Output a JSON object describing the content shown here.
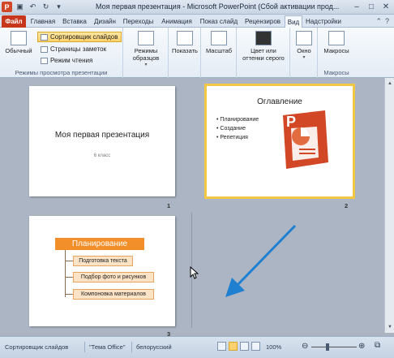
{
  "window": {
    "title": "Моя первая презентация - Microsoft PowerPoint (Сбой активации прод...",
    "app_icon": "P"
  },
  "tabs": [
    {
      "label": "Файл"
    },
    {
      "label": "Главная"
    },
    {
      "label": "Вставка"
    },
    {
      "label": "Дизайн"
    },
    {
      "label": "Переходы"
    },
    {
      "label": "Анимация"
    },
    {
      "label": "Показ слайд"
    },
    {
      "label": "Рецензиров"
    },
    {
      "label": "Вид"
    },
    {
      "label": "Надстройки"
    }
  ],
  "ribbon": {
    "group_presentation_views": {
      "label": "Режимы просмотра презентации",
      "normal": "Обычный",
      "slide_sorter": "Сортировщик слайдов",
      "notes_page": "Страницы заметок",
      "reading_view": "Режим чтения"
    },
    "masters": "Режимы образцов",
    "show": "Показать",
    "zoom": "Масштаб",
    "color_grayscale": "Цвет или оттенки серого",
    "window": "Окно",
    "macros": "Макросы",
    "group_macros_label": "Макросы"
  },
  "slides": [
    {
      "number": "1",
      "title": "Моя первая презентация",
      "subtitle": "6 класс"
    },
    {
      "number": "2",
      "title": "Оглавление",
      "bullets": [
        "Планирование",
        "Создание",
        "Репетиция"
      ]
    },
    {
      "number": "3",
      "title": "Планирование",
      "items": [
        "Подготовка текста",
        "Подбор фото и рисунков",
        "Компоновка материалов"
      ]
    }
  ],
  "statusbar": {
    "view": "Сортировщик слайдов",
    "theme": "\"Тема Office\"",
    "language": "белорусский",
    "zoom": "100%"
  },
  "colors": {
    "accent_file_tab": "#c7371c",
    "orange": "#f28f2a",
    "arrow": "#1f7fd1"
  }
}
